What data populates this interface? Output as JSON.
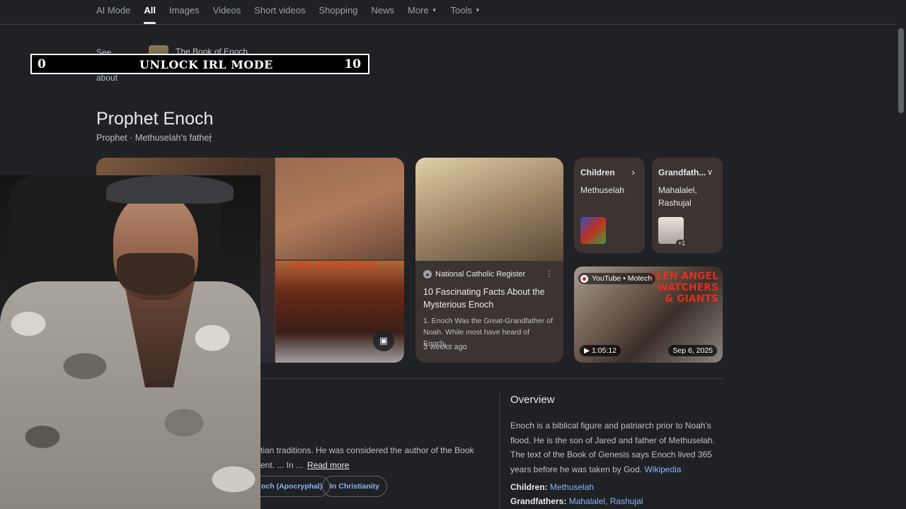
{
  "nav": {
    "tabs": [
      {
        "label": "AI Mode",
        "active": false
      },
      {
        "label": "All",
        "active": true
      },
      {
        "label": "Images",
        "active": false
      },
      {
        "label": "Videos",
        "active": false
      },
      {
        "label": "Short videos",
        "active": false
      },
      {
        "label": "Shopping",
        "active": false
      },
      {
        "label": "News",
        "active": false
      }
    ],
    "more_label": "More",
    "tools_label": "Tools"
  },
  "see_results": {
    "label": "See results about",
    "item_title": "The Book of Enoch"
  },
  "overlay": {
    "left_num": "0",
    "label": "UNLOCK IRL MODE",
    "right_num": "10"
  },
  "entity": {
    "title": "Prophet Enoch",
    "subtitle": "Prophet · Methuselah's father"
  },
  "images": {
    "collage_label": "THE ETHIOPIAN"
  },
  "article": {
    "source": "National Catholic Register",
    "headline": "10 Fascinating Facts About the Mysterious Enoch",
    "snippet": "1. Enoch Was the Great-Grandfather of Noah. While most have heard of Enoch,...",
    "date": "3 weeks ago"
  },
  "cards": {
    "children": {
      "heading": "Children",
      "value": "Methuselah"
    },
    "grandfathers": {
      "heading": "Grandfath...",
      "value": "Mahalalel, Rashujal",
      "badge": "+1"
    }
  },
  "video": {
    "source": "YouTube • Motech",
    "title_overlay": "LLEN ANGEL\nWATCHERS\n& GIANTS",
    "duration": "1:05:12",
    "date": "Sep 6, 2025"
  },
  "description": {
    "line1": "tian traditions. He was considered the author of the Book",
    "line2": "ent. ... In ...",
    "read_more": "Read more",
    "chips": [
      "och (Apocryphal)",
      "In Christianity"
    ]
  },
  "overview": {
    "title": "Overview",
    "text": "Enoch is a biblical figure and patriarch prior to Noah's flood. He is the son of Jared and father of Methuselah. The text of the Book of Genesis says Enoch lived 365 years before he was taken by God.",
    "source_link": "Wikipedia",
    "facts": [
      {
        "label": "Children:",
        "value": "Methuselah"
      },
      {
        "label": "Grandfathers:",
        "value": "Mahalalel, Rashujal"
      }
    ]
  }
}
